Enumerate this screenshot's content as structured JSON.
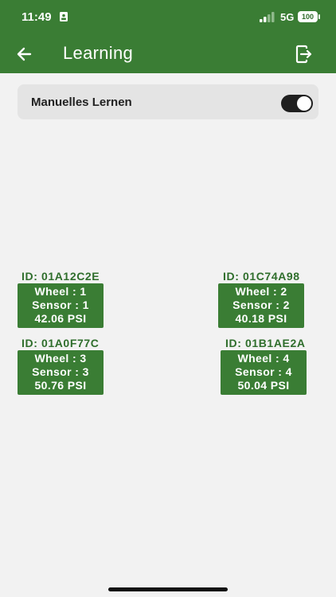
{
  "status_bar": {
    "time": "11:49",
    "network": "5G",
    "battery": "100"
  },
  "header": {
    "title": "Learning",
    "back_icon": "arrow-left-icon",
    "logout_icon": "exit-icon"
  },
  "manual_learning": {
    "label": "Manuelles Lernen",
    "toggle_on": true
  },
  "sensors": [
    {
      "id": "ID: 01A12C2E",
      "wheel": "Wheel : 1",
      "sensor": "Sensor : 1",
      "pressure": "42.06 PSI"
    },
    {
      "id": "ID: 01C74A98",
      "wheel": "Wheel : 2",
      "sensor": "Sensor : 2",
      "pressure": "40.18 PSI"
    },
    {
      "id": "ID: 01A0F77C",
      "wheel": "Wheel : 3",
      "sensor": "Sensor : 3",
      "pressure": "50.76 PSI"
    },
    {
      "id": "ID: 01B1AE2A",
      "wheel": "Wheel : 4",
      "sensor": "Sensor : 4",
      "pressure": "50.04 PSI"
    }
  ],
  "colors": {
    "primary": "#3a7d34",
    "id_text": "#2f6e2c",
    "background": "#f2f2f2"
  }
}
